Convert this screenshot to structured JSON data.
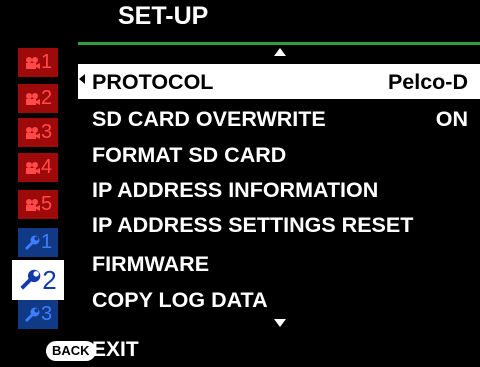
{
  "header": {
    "title": "SET-UP"
  },
  "tabs": [
    {
      "kind": "camera",
      "label": "1",
      "active": false
    },
    {
      "kind": "camera",
      "label": "2",
      "active": false
    },
    {
      "kind": "camera",
      "label": "3",
      "active": false
    },
    {
      "kind": "camera",
      "label": "4",
      "active": false
    },
    {
      "kind": "camera",
      "label": "5",
      "active": false
    },
    {
      "kind": "wrench",
      "label": "1",
      "active": false
    },
    {
      "kind": "wrench",
      "label": "2",
      "active": true
    },
    {
      "kind": "wrench",
      "label": "3",
      "active": false
    }
  ],
  "menu": {
    "items": [
      {
        "label": "PROTOCOL",
        "value": "Pelco-D",
        "selected": true
      },
      {
        "label": "SD CARD OVERWRITE",
        "value": "ON",
        "selected": false
      },
      {
        "label": "FORMAT SD CARD",
        "value": "",
        "selected": false
      },
      {
        "label": "IP ADDRESS INFORMATION",
        "value": "",
        "selected": false
      },
      {
        "label": "IP ADDRESS SETTINGS RESET",
        "value": "",
        "selected": false
      },
      {
        "label": "FIRMWARE",
        "value": "",
        "selected": false
      },
      {
        "label": "COPY LOG DATA",
        "value": "",
        "selected": false
      }
    ]
  },
  "footer": {
    "back_badge": "BACK",
    "exit_label": "EXIT"
  },
  "colors": {
    "accent_line": "#2e9f3f",
    "camera_tab_bg": "#9e0a0a",
    "camera_tab_fg": "#ff4a4a",
    "wrench_tab_bg": "#103a85",
    "wrench_tab_fg": "#3f7dff",
    "highlight": "#ffffff"
  }
}
